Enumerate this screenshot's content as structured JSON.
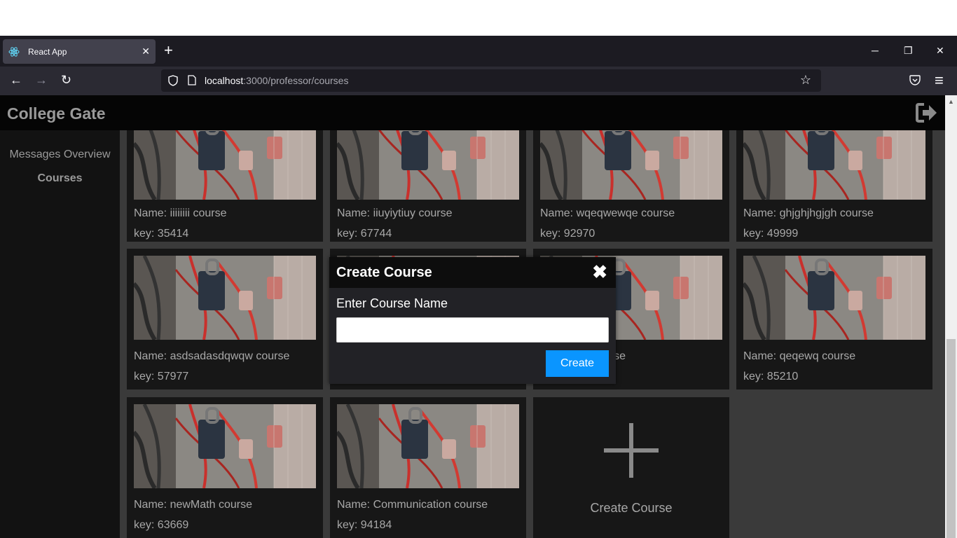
{
  "browser": {
    "tab_title": "React App",
    "tab_close": "✕",
    "new_tab": "+",
    "minimize": "─",
    "restore": "❐",
    "close": "✕",
    "back": "←",
    "forward": "→",
    "reload": "↻",
    "url_host": "localhost",
    "url_rest": ":3000/professor/courses",
    "star": "☆",
    "menu": "≡"
  },
  "app": {
    "brand": "College Gate"
  },
  "sidebar": {
    "items": [
      {
        "label": "Messages Overview",
        "active": false
      },
      {
        "label": "Courses",
        "active": true
      }
    ]
  },
  "courses": [
    {
      "name": "Name: iiiiiiii course",
      "key": "key: 35414"
    },
    {
      "name": "Name: iiuyiytiuy course",
      "key": "key: 67744"
    },
    {
      "name": "Name: wqeqwewqe course",
      "key": "key: 92970"
    },
    {
      "name": "Name: ghjghjhgjgh course",
      "key": "key: 49999"
    },
    {
      "name": "Name: asdsadasdqwqw course",
      "key": "key: 57977"
    },
    {
      "name": "",
      "key": ""
    },
    {
      "name": "course",
      "key": ""
    },
    {
      "name": "Name: qeqewq course",
      "key": "key: 85210"
    },
    {
      "name": "Name: newMath course",
      "key": "key: 63669"
    },
    {
      "name": "Name: Communication course",
      "key": "key: 94184"
    }
  ],
  "create_card": {
    "label": "Create Course"
  },
  "modal": {
    "title": "Create Course",
    "close": "✖",
    "label": "Enter Course Name",
    "input_value": "",
    "button": "Create"
  },
  "colors": {
    "accent": "#0a95ff",
    "header_bg": "#050505",
    "sidebar_bg": "#121212",
    "card_bg": "#171717"
  }
}
